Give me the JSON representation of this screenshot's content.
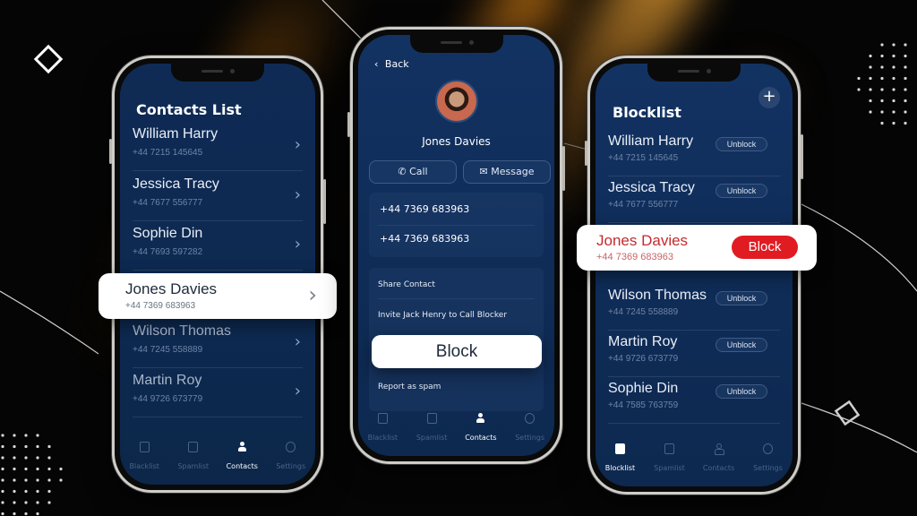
{
  "colors": {
    "screen_bg": "#0f2b55",
    "accent_red": "#e11b22",
    "callout_bg": "#ffffff",
    "streak_orange": "#e6a03a"
  },
  "phone1": {
    "title": "Contacts List",
    "contacts": [
      {
        "name": "William Harry",
        "phone": "+44 7215 145645"
      },
      {
        "name": "Jessica Tracy",
        "phone": "+44 7677 556777"
      },
      {
        "name": "Sophie Din",
        "phone": "+44 7693 597282"
      },
      {
        "name": "Jones Davies",
        "phone": "+44 7369 683963"
      },
      {
        "name": "Wilson Thomas",
        "phone": "+44 7245 558889"
      },
      {
        "name": "Martin Roy",
        "phone": "+44 9726 673779"
      }
    ],
    "highlighted": {
      "name": "Jones Davies",
      "phone": "+44 7369 683963"
    },
    "tabs": [
      {
        "label": "Blacklist",
        "icon": "blacklist-icon"
      },
      {
        "label": "Spamlist",
        "icon": "spamlist-icon"
      },
      {
        "label": "Contacts",
        "icon": "contacts-icon",
        "active": true
      },
      {
        "label": "Settings",
        "icon": "settings-icon"
      }
    ]
  },
  "phone2": {
    "back_label": "Back",
    "contact_name": "Jones Davies",
    "call_label": "Call",
    "message_label": "Message",
    "numbers": [
      "+44 7369 683963",
      "+44 7369 683963"
    ],
    "actions": {
      "share": "Share Contact",
      "invite": "Invite Jack Henry to Call Blocker",
      "block": "Block",
      "report": "Report as spam"
    },
    "tabs": [
      {
        "label": "Blacklist",
        "icon": "blacklist-icon"
      },
      {
        "label": "Spamlist",
        "icon": "spamlist-icon"
      },
      {
        "label": "Contacts",
        "icon": "contacts-icon",
        "active": true
      },
      {
        "label": "Settings",
        "icon": "settings-icon"
      }
    ]
  },
  "phone3": {
    "title": "Blocklist",
    "add_icon": "plus-icon",
    "unblock_label": "Unblock",
    "blocked": [
      {
        "name": "William Harry",
        "phone": "+44 7215 145645"
      },
      {
        "name": "Jessica Tracy",
        "phone": "+44 7677 556777"
      },
      {
        "name": "Wilson Thomas",
        "phone": "+44 7245 558889"
      },
      {
        "name": "Martin Roy",
        "phone": "+44 9726 673779"
      },
      {
        "name": "Sophie Din",
        "phone": "+44 7585 763759"
      }
    ],
    "highlighted": {
      "name": "Jones Davies",
      "phone": "+44 7369 683963",
      "button": "Block"
    },
    "tabs": [
      {
        "label": "Blocklist",
        "icon": "blocklist-icon",
        "active": true
      },
      {
        "label": "Spamlist",
        "icon": "spamlist-icon"
      },
      {
        "label": "Contacts",
        "icon": "contacts-icon"
      },
      {
        "label": "Settings",
        "icon": "settings-icon"
      }
    ]
  }
}
